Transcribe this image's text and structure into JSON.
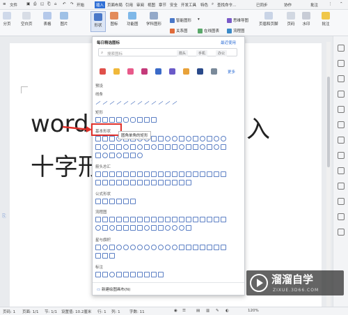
{
  "menubar": {
    "file": "文件",
    "tabs": [
      "开始",
      "插入",
      "页面布局",
      "引用",
      "审阅",
      "视图",
      "章节",
      "安全",
      "开发工具",
      "特色"
    ],
    "active_tab": "插入",
    "search": "查找命令...",
    "sync": "已同步",
    "collab": "协作",
    "comment": "批注"
  },
  "ribbon": {
    "groups": [
      {
        "label": "分页"
      },
      {
        "label": "空白页"
      },
      {
        "label": "表格"
      },
      {
        "label": "图片"
      },
      {
        "label": "形状"
      },
      {
        "label": "图标"
      },
      {
        "label": "功能图"
      },
      {
        "label": "学科图形"
      }
    ],
    "smart_graphic": "智能图形",
    "relation_graph": "关系图",
    "online_chart": "在线图表",
    "mind_map": "思维导图",
    "flowchart": "流程图",
    "header_footer": "页眉和页脚",
    "page_number": "页码",
    "watermark": "水印",
    "comment": "批注"
  },
  "panel": {
    "title": "每日精选图标",
    "more_link": "最近使用",
    "search_placeholder": "搜索图标",
    "chips": [
      "箭头",
      "手机",
      "办公"
    ],
    "more": "更多",
    "preset": "预设",
    "sections": [
      "线条",
      "矩形",
      "基本形状",
      "箭头总汇",
      "公式形状",
      "流程图",
      "星与旗帜",
      "标注"
    ],
    "new_canvas": "新建绘图画布(N)"
  },
  "tooltip": "圆角单角的矩形",
  "document": {
    "line1_left": "word",
    "line1_right": "入",
    "line2": "十字形"
  },
  "status": {
    "page": "页码: 1",
    "pages": "页面: 1/1",
    "section": "节: 1/1",
    "setting": "设置值: 10.2厘米",
    "row": "行: 1",
    "col": "列: 1",
    "words": "字数: 11",
    "zoom": "120%"
  },
  "watermark_logo": {
    "name": "溜溜自学",
    "site": "ZIXUE.3D66.COM"
  },
  "colors": {
    "accent": "#2f6fd6",
    "highlight": "#e0302a"
  }
}
